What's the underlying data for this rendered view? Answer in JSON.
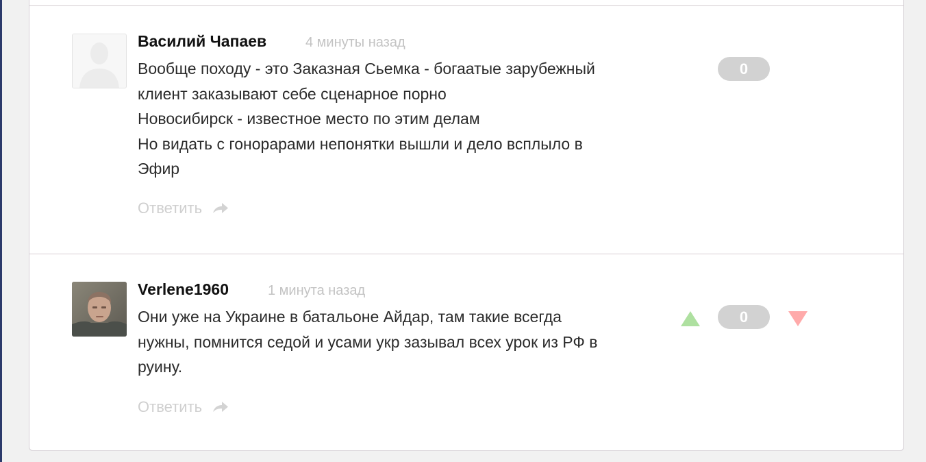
{
  "comments": [
    {
      "author": "Василий Чапаев",
      "time": "4 минуты назад",
      "lines": [
        "Вообще походу - это Заказная Сьемка - богаатые зарубежный",
        "клиент заказывают себе сценарное порно",
        "Новосибирск - известное место по этим делам",
        "Но видать с гонорарами непонятки вышли и дело всплыло в",
        "Эфир"
      ],
      "score": "0",
      "reply_label": "Ответить",
      "avatar": "default-avatar-icon"
    },
    {
      "author": "Verlene1960",
      "time": "1 минута назад",
      "lines": [
        "Они уже на Украине в батальоне Айдар, там такие всегда",
        "нужны, помнится седой и усами укр зазывал всех урок из РФ в",
        "руину."
      ],
      "score": "0",
      "reply_label": "Ответить",
      "avatar": "user-photo",
      "vote_up_color": "#aee0a0",
      "vote_down_color": "#ffaaaa"
    }
  ]
}
